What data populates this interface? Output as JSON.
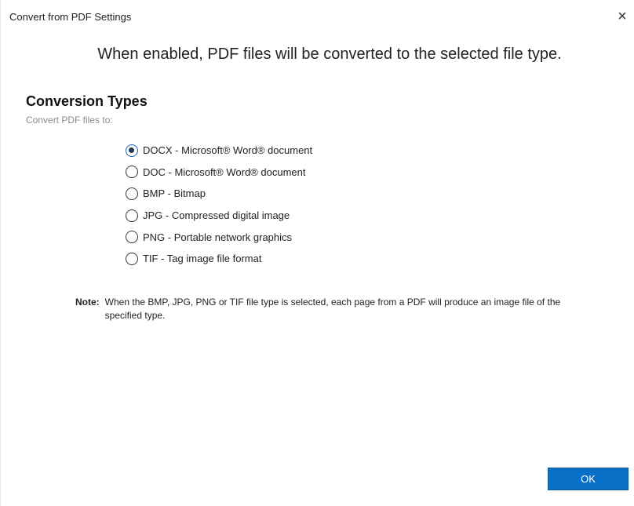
{
  "dialog": {
    "title": "Convert from PDF Settings",
    "close_glyph": "×",
    "header_message": "When enabled, PDF files will be converted to the selected file type."
  },
  "conversion": {
    "heading": "Conversion Types",
    "subheading": "Convert PDF files to:",
    "selected": "DOCX",
    "options": [
      {
        "label": "DOCX - Microsoft® Word® document",
        "checked": true
      },
      {
        "label": "DOC - Microsoft® Word® document",
        "checked": false
      },
      {
        "label": "BMP - Bitmap",
        "checked": false
      },
      {
        "label": "JPG - Compressed digital image",
        "checked": false
      },
      {
        "label": "PNG - Portable network graphics",
        "checked": false
      },
      {
        "label": "TIF - Tag image file format",
        "checked": false
      }
    ]
  },
  "note": {
    "label": "Note:",
    "text": "When the BMP, JPG, PNG or TIF file type is selected, each page from a PDF will produce an image file of the specified type."
  },
  "footer": {
    "ok_label": "OK"
  },
  "colors": {
    "ok_button": "#0a6fc7",
    "radio_selected": "#1f3550"
  },
  "icons": {
    "close": "close-icon",
    "radio": "radio-button-icon"
  }
}
